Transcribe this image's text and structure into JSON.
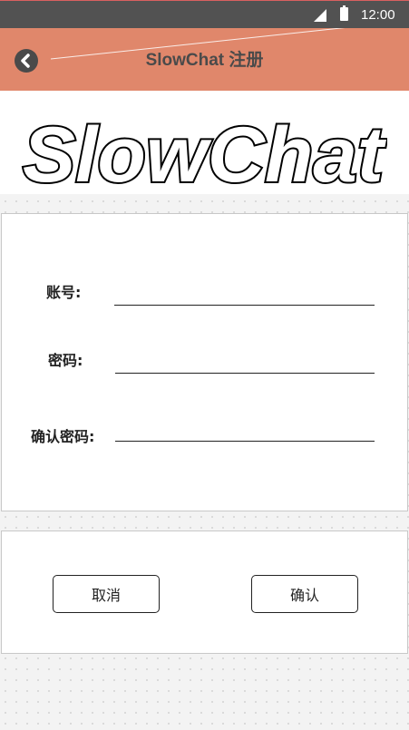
{
  "status_bar": {
    "time": "12:00",
    "icons": [
      "signal-icon",
      "battery-icon"
    ]
  },
  "header": {
    "title_en": "SlowChat",
    "title_cn": "注册",
    "back_icon": "back-circle-icon",
    "background_color": "#e0876b"
  },
  "logo": {
    "text": "SlowChat"
  },
  "form": {
    "fields": [
      {
        "label": "账号:",
        "value": ""
      },
      {
        "label": "密码:",
        "value": ""
      },
      {
        "label": "确认密码:",
        "value": ""
      }
    ]
  },
  "actions": {
    "cancel_label": "取消",
    "confirm_label": "确认"
  }
}
